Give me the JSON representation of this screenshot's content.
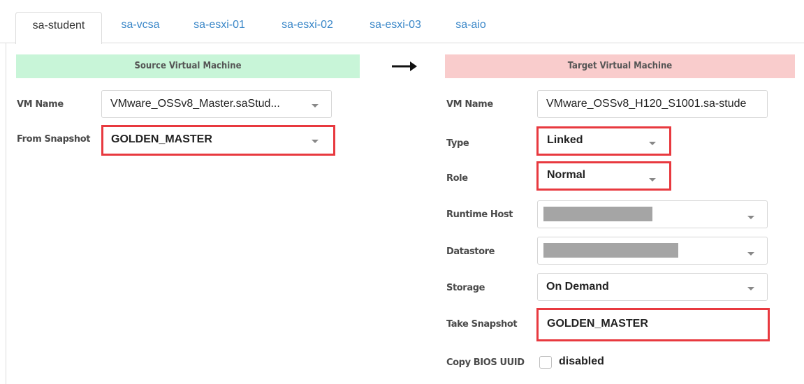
{
  "tabs": [
    {
      "label": "sa-student",
      "active": true
    },
    {
      "label": "sa-vcsa",
      "active": false
    },
    {
      "label": "sa-esxi-01",
      "active": false
    },
    {
      "label": "sa-esxi-02",
      "active": false
    },
    {
      "label": "sa-esxi-03",
      "active": false
    },
    {
      "label": "sa-aio",
      "active": false
    }
  ],
  "source": {
    "header": "Source Virtual Machine",
    "vm_name_label": "VM Name",
    "vm_name_value": "VMware_OSSv8_Master.saStud...",
    "snapshot_label": "From Snapshot",
    "snapshot_value": "GOLDEN_MASTER"
  },
  "target": {
    "header": "Target Virtual Machine",
    "vm_name_label": "VM Name",
    "vm_name_value": "VMware_OSSv8_H120_S1001.sa-stude",
    "type_label": "Type",
    "type_value": "Linked",
    "role_label": "Role",
    "role_value": "Normal",
    "runtime_host_label": "Runtime Host",
    "datastore_label": "Datastore",
    "storage_label": "Storage",
    "storage_value": "On Demand",
    "take_snapshot_label": "Take Snapshot",
    "take_snapshot_value": "GOLDEN_MASTER",
    "copy_bios_label": "Copy BIOS UUID",
    "copy_bios_value": "disabled"
  },
  "colors": {
    "source_header_bg": "#c8f5d8",
    "target_header_bg": "#f9cccc",
    "highlight": "#e8393f",
    "tab_link": "#3a87c8"
  }
}
